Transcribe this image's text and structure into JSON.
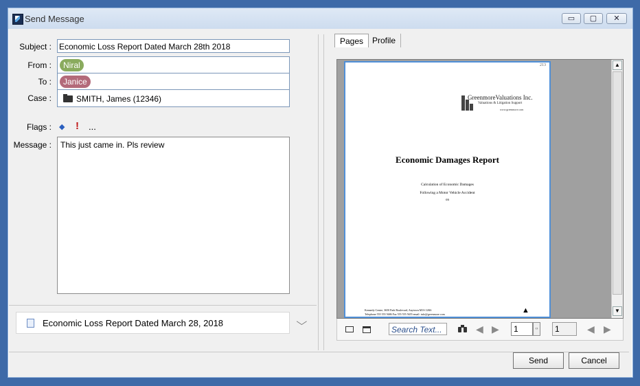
{
  "window": {
    "title": "Send Message",
    "minimize": "▭",
    "maximize": "▢",
    "close": "✕"
  },
  "form": {
    "subject_label": "Subject :",
    "subject_value": "Economic Loss Report Dated March 28th 2018",
    "from_label": "From :",
    "from_value": "Niral",
    "to_label": "To :",
    "to_value": "Janice",
    "case_label": "Case :",
    "case_value": "SMITH, James (12346)",
    "flags_label": "Flags :",
    "flags_more": "...",
    "message_label": "Message :",
    "message_value": "This just came in. Pls review"
  },
  "attachment": {
    "name": "Economic Loss Report Dated March 28, 2018"
  },
  "tabs": [
    {
      "label": "Pages"
    },
    {
      "label": "Profile"
    }
  ],
  "document": {
    "page_number": "213",
    "company": "GreenmoreValuations Inc.",
    "company_tagline": "Valuations & Litigation Support",
    "company_site": "www.greenmore.com",
    "title": "Economic Damages Report",
    "line1": "Calculation of Economic Damages",
    "line2": "Following a Motor Vehicle Accident",
    "line3": "on",
    "footer1": "Kennedy Centre, 3650 Park Boulevard, Anytown M1S 12K6",
    "footer2": "Telephone 555 555 5686 Fax 555 555 5655 email: info@greenmore.com"
  },
  "toolbar": {
    "search_placeholder": "Search Text...",
    "page_current": "1",
    "page_total": "1"
  },
  "buttons": {
    "send": "Send",
    "cancel": "Cancel"
  },
  "colors": {
    "from_chip": "#8aab5e",
    "to_chip": "#b36a7a",
    "page_border": "#4f8fd8",
    "flag_blue": "#2a5fbf",
    "flag_red": "#c01818"
  }
}
